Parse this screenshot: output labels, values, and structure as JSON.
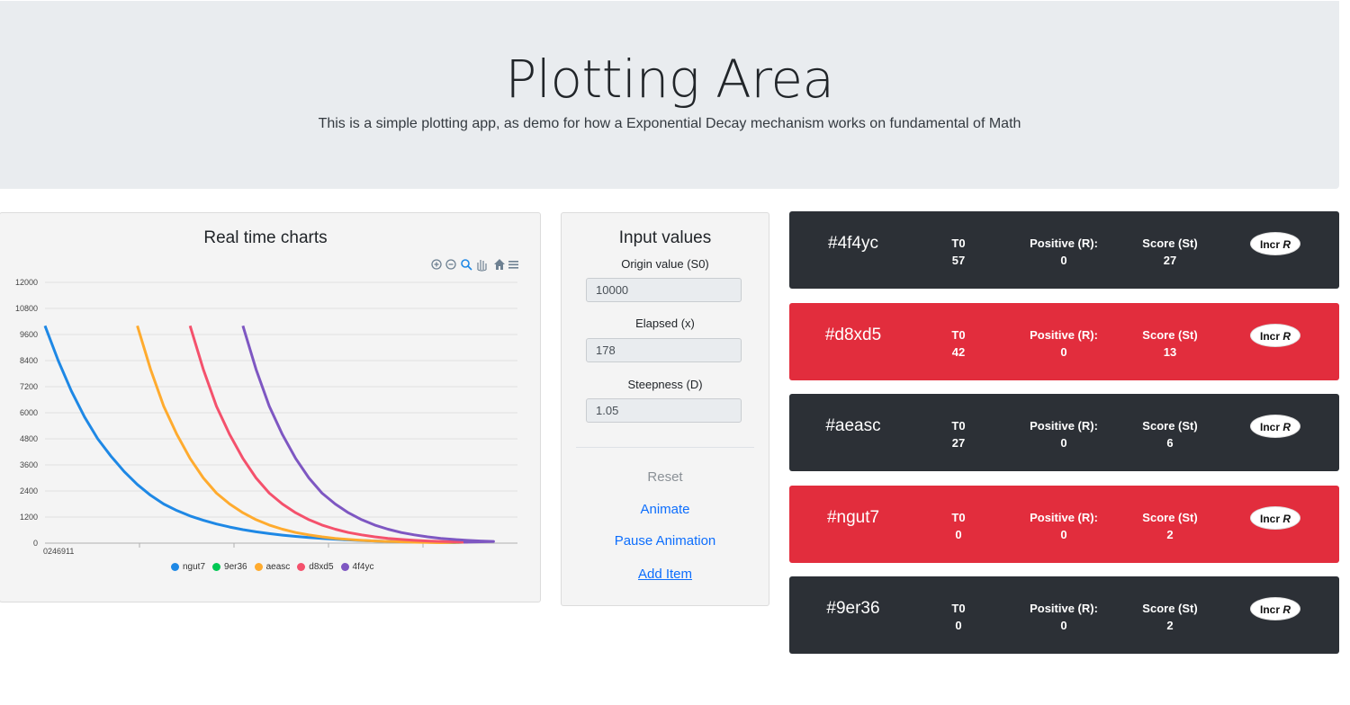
{
  "header": {
    "title": "Plotting Area",
    "subtitle": "This is a simple plotting app, as demo for how a Exponential Decay mechanism works on fundamental of Math"
  },
  "chart_card": {
    "title": "Real time charts",
    "toolbar_icons": [
      "zoom-in-icon",
      "zoom-out-icon",
      "zoom-select-icon",
      "pan-hand-icon",
      "home-icon",
      "menu-icon"
    ]
  },
  "chart_data": {
    "type": "line",
    "title": "",
    "xlabel": "",
    "ylabel": "",
    "ylim": [
      0,
      12000
    ],
    "yticks": [
      0,
      1200,
      2400,
      3600,
      4800,
      6000,
      7200,
      8400,
      9600,
      10800,
      12000
    ],
    "xtick_label": "0246911",
    "grid": true,
    "legend_position": "bottom",
    "series": [
      {
        "name": "ngut7",
        "color": "#1e88e5",
        "start": 0,
        "values": [
          10000,
          8400,
          7000,
          5800,
          4800,
          4000,
          3300,
          2700,
          2200,
          1800,
          1500,
          1250,
          1050,
          880,
          740,
          620,
          520,
          440,
          370,
          310,
          260,
          220,
          180,
          150,
          120,
          100,
          80,
          60,
          50,
          40,
          30,
          20
        ]
      },
      {
        "name": "9er36",
        "color": "#00c853",
        "start": 0,
        "values": []
      },
      {
        "name": "aeasc",
        "color": "#ffab2e",
        "start": 7,
        "values": [
          10000,
          8000,
          6300,
          5000,
          3900,
          3000,
          2300,
          1800,
          1400,
          1080,
          830,
          640,
          490,
          380,
          290,
          220,
          170,
          130,
          100,
          80,
          60,
          40,
          30,
          20
        ]
      },
      {
        "name": "d8xd5",
        "color": "#f4516c",
        "start": 11,
        "values": [
          10000,
          8000,
          6300,
          5000,
          3900,
          3000,
          2300,
          1800,
          1400,
          1080,
          830,
          640,
          490,
          380,
          290,
          220,
          170,
          130,
          100,
          80,
          60,
          40
        ]
      },
      {
        "name": "4f4yc",
        "color": "#7e57c2",
        "start": 15,
        "values": [
          10000,
          8000,
          6300,
          5000,
          3900,
          3000,
          2300,
          1800,
          1400,
          1080,
          830,
          640,
          490,
          380,
          290,
          220,
          170,
          130,
          100,
          80
        ]
      }
    ]
  },
  "input_card": {
    "title": "Input values",
    "origin_label": "Origin value (S0)",
    "origin_value": "10000",
    "elapsed_label": "Elapsed (x)",
    "elapsed_value": "178",
    "steepness_label": "Steepness (D)",
    "steepness_value": "1.05",
    "reset": "Reset",
    "animate": "Animate",
    "pause": "Pause Animation",
    "add": "Add Item"
  },
  "items": [
    {
      "id": "#4f4yc",
      "t0_label": "T0",
      "t0": "57",
      "pos_label": "Positive (R):",
      "pos": "0",
      "score_label": "Score (St)",
      "score": "27",
      "button": "Incr",
      "button_var": "R",
      "color": "#2c3036"
    },
    {
      "id": "#d8xd5",
      "t0_label": "T0",
      "t0": "42",
      "pos_label": "Positive (R):",
      "pos": "0",
      "score_label": "Score (St)",
      "score": "13",
      "button": "Incr",
      "button_var": "R",
      "color": "#e22d3d"
    },
    {
      "id": "#aeasc",
      "t0_label": "T0",
      "t0": "27",
      "pos_label": "Positive (R):",
      "pos": "0",
      "score_label": "Score (St)",
      "score": "6",
      "button": "Incr",
      "button_var": "R",
      "color": "#2c3036"
    },
    {
      "id": "#ngut7",
      "t0_label": "T0",
      "t0": "0",
      "pos_label": "Positive (R):",
      "pos": "0",
      "score_label": "Score (St)",
      "score": "2",
      "button": "Incr",
      "button_var": "R",
      "color": "#e22d3d"
    },
    {
      "id": "#9er36",
      "t0_label": "T0",
      "t0": "0",
      "pos_label": "Positive (R):",
      "pos": "0",
      "score_label": "Score (St)",
      "score": "2",
      "button": "Incr",
      "button_var": "R",
      "color": "#2c3036"
    }
  ]
}
